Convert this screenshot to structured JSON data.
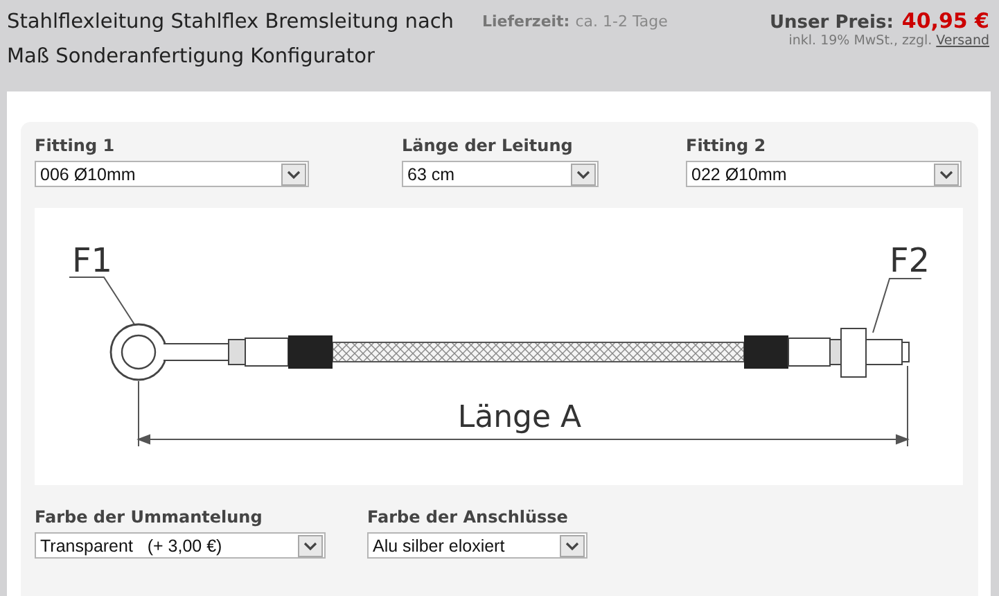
{
  "header": {
    "title": "Stahlflexleitung Stahlflex Bremsleitung nach Maß Sonderanfertigung Konfigurator",
    "delivery_label": "Lieferzeit:",
    "delivery_value": "ca. 1-2 Tage",
    "price_label": "Unser Preis:",
    "price": "40,95 €",
    "tax_note": "inkl. 19% MwSt., zzgl.",
    "shipping_link": "Versand"
  },
  "top_selects": [
    {
      "label": "Fitting 1",
      "value": "006 Ø10mm"
    },
    {
      "label": "Länge der Leitung",
      "value": "63 cm"
    },
    {
      "label": "Fitting 2",
      "value": "022 Ø10mm"
    }
  ],
  "diagram": {
    "left_label": "F1",
    "right_label": "F2",
    "length_label": "Länge A"
  },
  "bottom_selects": [
    {
      "label": "Farbe der Ummantelung",
      "value": "Transparent   (+ 3,00 €)"
    },
    {
      "label": "Farbe der Anschlüsse",
      "value": "Alu silber eloxiert"
    }
  ]
}
